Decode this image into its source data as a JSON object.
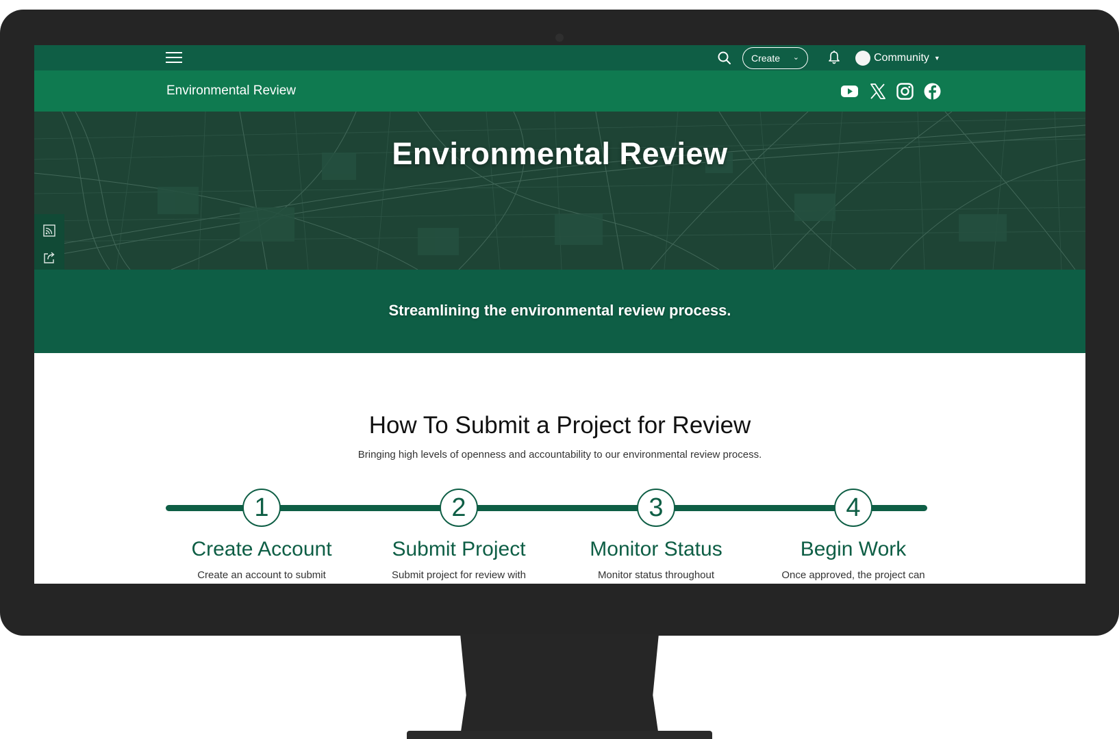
{
  "nav": {
    "create_label": "Create",
    "community_label": "Community"
  },
  "site": {
    "title": "Environmental Review"
  },
  "hero": {
    "title": "Environmental Review"
  },
  "tagline": "Streamlining the environmental review process.",
  "steps_section": {
    "title": "How To Submit a Project for Review",
    "subtitle": "Bringing high levels of openness and accountability to our environmental review process.",
    "steps": [
      {
        "number": "1",
        "title": "Create Account",
        "desc": "Create an account to submit"
      },
      {
        "number": "2",
        "title": "Submit Project",
        "desc": "Submit project for review with"
      },
      {
        "number": "3",
        "title": "Monitor Status",
        "desc": "Monitor status throughout"
      },
      {
        "number": "4",
        "title": "Begin Work",
        "desc": "Once approved, the project can"
      }
    ]
  },
  "colors": {
    "nav_bg": "#0f5e45",
    "subheader_bg": "#0f7a50",
    "hero_bg": "#1e4435",
    "accent": "#0e5e45",
    "monitor_frame": "#252525"
  },
  "icons": {
    "menu": "hamburger-icon",
    "search": "search-icon",
    "notifications": "bell-icon",
    "social": [
      "youtube-icon",
      "x-icon",
      "instagram-icon",
      "facebook-icon"
    ],
    "side_tools": [
      "rss-icon",
      "share-icon"
    ]
  }
}
